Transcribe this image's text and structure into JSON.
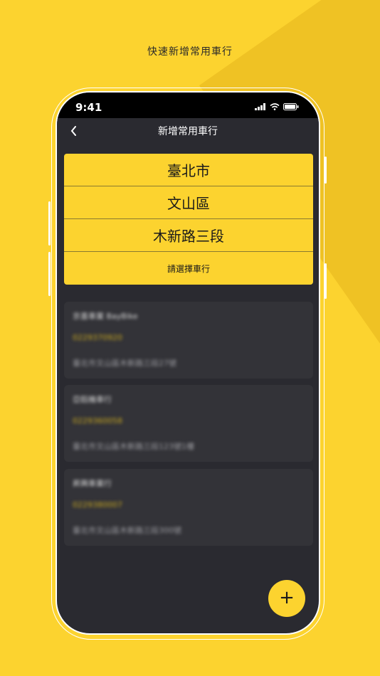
{
  "headline": "快速新增常用車行",
  "status": {
    "time": "9:41"
  },
  "nav": {
    "back_icon": "chevron-left-icon",
    "title": "新增常用車行"
  },
  "selector": {
    "city": "臺北市",
    "district": "文山區",
    "road": "木新路三段",
    "shop_prompt": "請選擇車行"
  },
  "shops": [
    {
      "name": "京喜車業 BayBike",
      "phone": "0229370920",
      "address": "臺北市文山區木新路三段27號"
    },
    {
      "name": "亞鈺機車行",
      "phone": "0229360058",
      "address": "臺北市文山區木新路三段123號1樓"
    },
    {
      "name": "昇興車業行",
      "phone": "0229380007",
      "address": "臺北市文山區木新路三段300號"
    }
  ],
  "fab": {
    "label": "+",
    "icon": "plus-icon"
  },
  "colors": {
    "accent": "#fcd32f",
    "background": "#2a2a30",
    "card": "#333338"
  }
}
